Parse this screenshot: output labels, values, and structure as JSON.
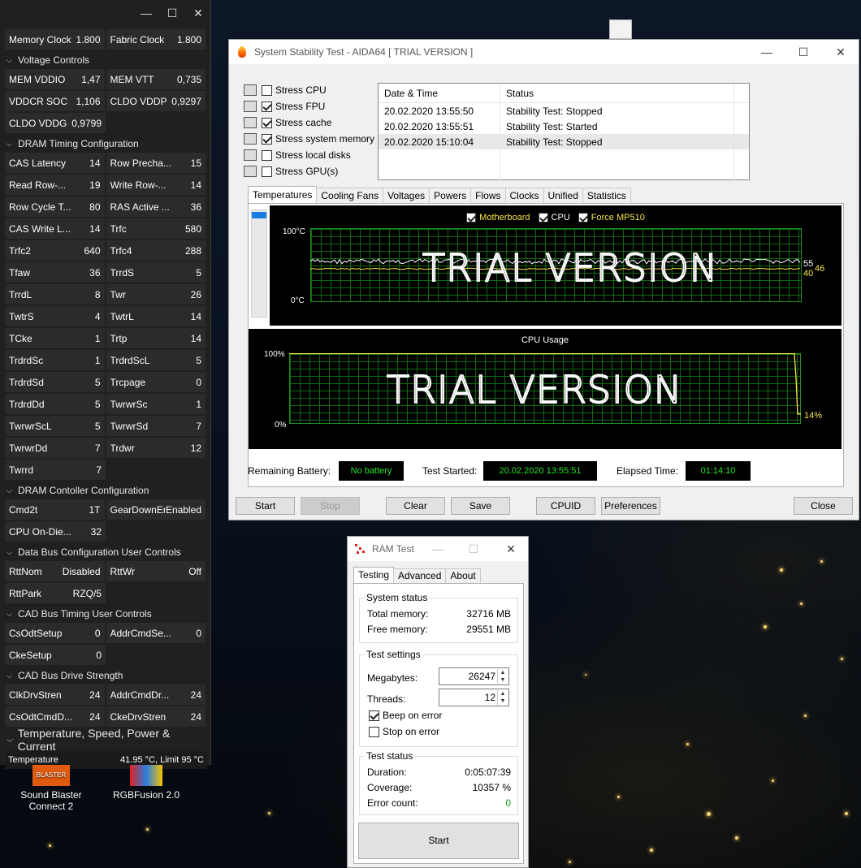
{
  "zt": {
    "top_pairs": [
      [
        "Memory Clock",
        "1.800",
        "Fabric Clock",
        "1.800"
      ]
    ],
    "sections": [
      {
        "title": "Voltage Controls",
        "rows": [
          [
            "MEM VDDIO",
            "1,47",
            "MEM VTT",
            "0,735"
          ],
          [
            "VDDCR SOC",
            "1,106",
            "CLDO VDDP",
            "0,9297"
          ],
          [
            "CLDO VDDG",
            "0,9799",
            "",
            ""
          ]
        ]
      },
      {
        "title": "DRAM Timing Configuration",
        "rows": [
          [
            "CAS Latency",
            "14",
            "Row Precha...",
            "15"
          ],
          [
            "Read Row-...",
            "19",
            "Write Row-...",
            "14"
          ],
          [
            "Row Cycle T...",
            "80",
            "RAS Active ...",
            "36"
          ],
          [
            "CAS Write L...",
            "14",
            "Trfc",
            "580"
          ],
          [
            "Trfc2",
            "640",
            "Trfc4",
            "288"
          ],
          [
            "Tfaw",
            "36",
            "TrrdS",
            "5"
          ],
          [
            "TrrdL",
            "8",
            "Twr",
            "26"
          ],
          [
            "TwtrS",
            "4",
            "TwtrL",
            "14"
          ],
          [
            "TCke",
            "1",
            "Trtp",
            "14"
          ],
          [
            "TrdrdSc",
            "1",
            "TrdrdScL",
            "5"
          ],
          [
            "TrdrdSd",
            "5",
            "Trcpage",
            "0"
          ],
          [
            "TrdrdDd",
            "5",
            "TwrwrSc",
            "1"
          ],
          [
            "TwrwrScL",
            "5",
            "TwrwrSd",
            "7"
          ],
          [
            "TwrwrDd",
            "7",
            "Trdwr",
            "12"
          ],
          [
            "Twrrd",
            "7",
            "",
            ""
          ]
        ]
      },
      {
        "title": "DRAM Contoller Configuration",
        "rows": [
          [
            "Cmd2t",
            "1T",
            "GearDownEn",
            "Enabled"
          ],
          [
            "CPU On-Die...",
            "32",
            "",
            ""
          ]
        ]
      },
      {
        "title": "Data Bus Configuration User Controls",
        "rows": [
          [
            "RttNom",
            "Disabled",
            "RttWr",
            "Off"
          ],
          [
            "RttPark",
            "RZQ/5",
            "",
            ""
          ]
        ]
      },
      {
        "title": "CAD Bus Timing User Controls",
        "rows": [
          [
            "CsOdtSetup",
            "0",
            "AddrCmdSe...",
            "0"
          ],
          [
            "CkeSetup",
            "0",
            "",
            ""
          ]
        ]
      },
      {
        "title": "CAD Bus Drive Strength",
        "rows": [
          [
            "ClkDrvStren",
            "24",
            "AddrCmdDr...",
            "24"
          ],
          [
            "CsOdtCmdD...",
            "24",
            "CkeDrvStren",
            "24"
          ]
        ]
      }
    ],
    "big_section": "Temperature, Speed, Power & Current",
    "temp_label": "Temperature",
    "temp_value": "41.95 °C, Limit 95 °C"
  },
  "desktop": {
    "icon1": {
      "line1": "Sound Blaster",
      "line2": "Connect 2",
      "badge": "BLASTER"
    },
    "icon2": {
      "label": "RGBFusion 2.0"
    }
  },
  "aida": {
    "title": "System Stability Test - AIDA64  [ TRIAL VERSION ]",
    "stress": [
      {
        "label": "Stress CPU",
        "checked": false,
        "icon": "cpu-icon"
      },
      {
        "label": "Stress FPU",
        "checked": true,
        "icon": "fpu-icon"
      },
      {
        "label": "Stress cache",
        "checked": true,
        "icon": "cache-icon"
      },
      {
        "label": "Stress system memory",
        "checked": true,
        "icon": "memory-icon"
      },
      {
        "label": "Stress local disks",
        "checked": false,
        "icon": "disk-icon"
      },
      {
        "label": "Stress GPU(s)",
        "checked": false,
        "icon": "gpu-icon"
      }
    ],
    "log_headers": [
      "Date & Time",
      "Status"
    ],
    "log_rows": [
      [
        "20.02.2020 13:55:50",
        "Stability Test: Stopped"
      ],
      [
        "20.02.2020 13:55:51",
        "Stability Test: Started"
      ],
      [
        "20.02.2020 15:10:04",
        "Stability Test: Stopped"
      ]
    ],
    "tabs": [
      "Temperatures",
      "Cooling Fans",
      "Voltages",
      "Powers",
      "Flows",
      "Clocks",
      "Unified",
      "Statistics"
    ],
    "temp_graph": {
      "legend": [
        {
          "label": "Motherboard",
          "color": "#f5e44a"
        },
        {
          "label": "CPU",
          "color": "#ffffff"
        },
        {
          "label": "Force MP510",
          "color": "#f5e44a"
        }
      ],
      "ymax_label": "100°C",
      "ymin_label": "0°C",
      "readout_cpu": "55",
      "readout_mb": "40",
      "readout_ssd": "46",
      "watermark": "TRIAL VERSION"
    },
    "cpu_graph": {
      "title": "CPU Usage",
      "ymax_label": "100%",
      "ymin_label": "0%",
      "readout": "14%",
      "watermark": "TRIAL VERSION"
    },
    "status": {
      "battery_label": "Remaining Battery:",
      "battery_value": "No battery",
      "started_label": "Test Started:",
      "started_value": "20.02.2020 13:55:51",
      "elapsed_label": "Elapsed Time:",
      "elapsed_value": "01:14:10"
    },
    "buttons": {
      "start": "Start",
      "stop": "Stop",
      "clear": "Clear",
      "save": "Save",
      "cpuid": "CPUID",
      "preferences": "Preferences",
      "close": "Close"
    }
  },
  "ram": {
    "title": "RAM Test",
    "tabs": [
      "Testing",
      "Advanced",
      "About"
    ],
    "system_status": {
      "title": "System status",
      "total_label": "Total memory:",
      "total_value": "32716 MB",
      "free_label": "Free memory:",
      "free_value": "29551 MB"
    },
    "test_settings": {
      "title": "Test settings",
      "mb_label": "Megabytes:",
      "mb_value": "26247",
      "threads_label": "Threads:",
      "threads_value": "12",
      "beep_label": "Beep on error",
      "beep_checked": true,
      "stop_label": "Stop on error",
      "stop_checked": false
    },
    "test_status": {
      "title": "Test status",
      "duration_label": "Duration:",
      "duration_value": "0:05:07:39",
      "coverage_label": "Coverage:",
      "coverage_value": "10357 %",
      "errors_label": "Error count:",
      "errors_value": "0"
    },
    "start_label": "Start"
  }
}
